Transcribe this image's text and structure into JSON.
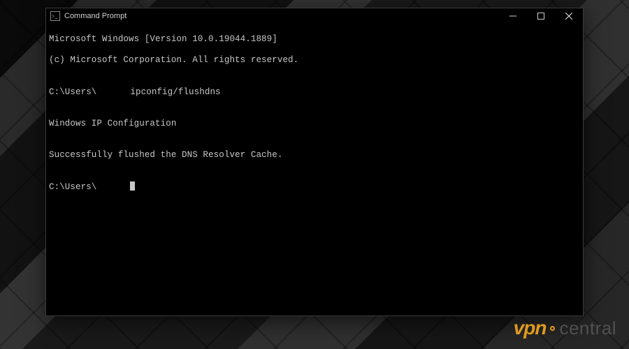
{
  "window": {
    "title": "Command Prompt"
  },
  "terminal": {
    "line1": "Microsoft Windows [Version 10.0.19044.1889]",
    "line2": "(c) Microsoft Corporation. All rights reserved.",
    "blank1": "",
    "prompt1_prefix": "C:\\Users\\",
    "prompt1_cmd": "ipconfig/flushdns",
    "blank2": "",
    "line3": "Windows IP Configuration",
    "blank3": "",
    "line4": "Successfully flushed the DNS Resolver Cache.",
    "blank4": "",
    "prompt2_prefix": "C:\\Users\\"
  },
  "watermark": {
    "left": "vpn",
    "right": "central"
  }
}
